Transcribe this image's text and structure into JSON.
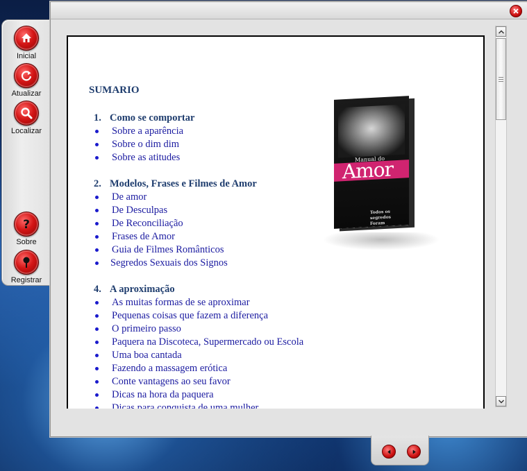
{
  "toolbar": {
    "items": [
      {
        "label": "Inicial",
        "icon": "home-icon"
      },
      {
        "label": "Atualizar",
        "icon": "refresh-icon"
      },
      {
        "label": "Localizar",
        "icon": "search-icon"
      },
      {
        "label": "Sobre",
        "icon": "help-icon"
      },
      {
        "label": "Registrar",
        "icon": "pin-icon"
      }
    ]
  },
  "window": {
    "close_icon": "close-icon",
    "accent_color": "#cc1010"
  },
  "document": {
    "title": "SUMARIO",
    "sections": [
      {
        "number": "1.",
        "heading": "Como se comportar",
        "items": [
          "Sobre a aparência",
          "Sobre o dim dim",
          "Sobre as atitudes"
        ]
      },
      {
        "number": "2.",
        "heading": "Modelos, Frases e Filmes de Amor",
        "items": [
          "De amor",
          "De Desculpas",
          "De Reconciliação",
          "Frases de Amor",
          "Guia de Filmes Românticos",
          "Segredos Sexuais dos Signos"
        ]
      },
      {
        "number": "4.",
        "heading": "A aproximação",
        "items": [
          "As muitas formas de se aproximar",
          "Pequenas coisas que fazem a diferença",
          "O primeiro passo",
          "Paquera na Discoteca, Supermercado ou Escola",
          "Uma boa cantada",
          "Fazendo a massagem erótica",
          "Conte vantagens ao seu favor",
          "Dicas na hora da paquera",
          "Dicas para conquista de uma mulher"
        ]
      }
    ],
    "book": {
      "small_title": "Manual do",
      "title": "Amor",
      "subtitle": "Todos os segredos Foram Revelados"
    }
  },
  "nav": {
    "prev_icon": "arrow-left-icon",
    "next_icon": "arrow-right-icon"
  }
}
